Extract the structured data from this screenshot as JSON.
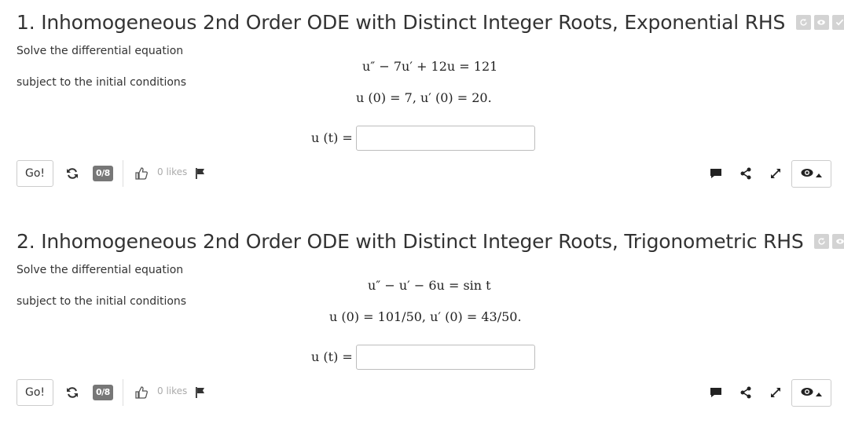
{
  "problems": [
    {
      "title": "1. Inhomogeneous 2nd Order ODE with Distinct Integer Roots, Exponential RHS",
      "solve_text": "Solve the differential equation",
      "equation": "u″ − 7u′ + 12u = 121",
      "subject_text": "subject to the initial conditions",
      "initial_conditions": "u (0) = 7,    u′ (0) = 20.",
      "answer_label": "u (t) =",
      "answer_value": "",
      "go_label": "Go!",
      "score": "0/8",
      "likes": "0 likes"
    },
    {
      "title": "2. Inhomogeneous 2nd Order ODE with Distinct Integer Roots, Trigonometric RHS",
      "solve_text": "Solve the differential equation",
      "equation": "u″ − u′ − 6u = sin t",
      "subject_text": "subject to the initial conditions",
      "initial_conditions": "u (0) = 101/50,    u′ (0) = 43/50.",
      "answer_label": "u (t) =",
      "answer_value": "",
      "go_label": "Go!",
      "score": "0/8",
      "likes": "0 likes"
    }
  ],
  "icons": {
    "badges": [
      "refresh-icon",
      "eye-icon",
      "check-icon"
    ],
    "toolbar_left": [
      "regenerate-icon",
      "thumbs-up-icon",
      "flag-icon"
    ],
    "toolbar_right": [
      "comment-icon",
      "share-icon",
      "expand-icon",
      "eye-icon",
      "caret-up-icon"
    ]
  },
  "colors": {
    "badge": "#d3d3d3",
    "score_badge": "#777777",
    "text": "#333333",
    "muted": "#aaaaaa"
  }
}
